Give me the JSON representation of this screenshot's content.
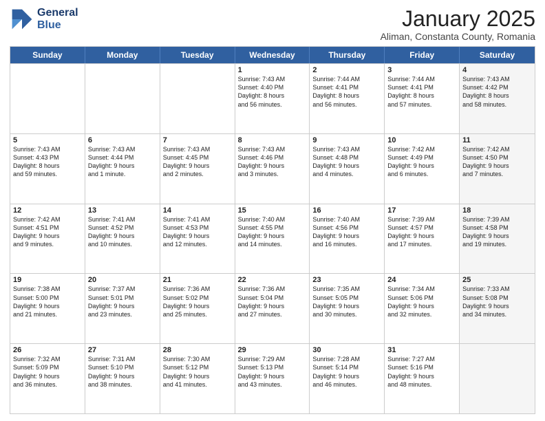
{
  "header": {
    "logo_line1": "General",
    "logo_line2": "Blue",
    "month": "January 2025",
    "location": "Aliman, Constanta County, Romania"
  },
  "days_of_week": [
    "Sunday",
    "Monday",
    "Tuesday",
    "Wednesday",
    "Thursday",
    "Friday",
    "Saturday"
  ],
  "weeks": [
    [
      {
        "num": "",
        "text": "",
        "shaded": false
      },
      {
        "num": "",
        "text": "",
        "shaded": false
      },
      {
        "num": "",
        "text": "",
        "shaded": false
      },
      {
        "num": "1",
        "text": "Sunrise: 7:43 AM\nSunset: 4:40 PM\nDaylight: 8 hours\nand 56 minutes.",
        "shaded": false
      },
      {
        "num": "2",
        "text": "Sunrise: 7:44 AM\nSunset: 4:41 PM\nDaylight: 8 hours\nand 56 minutes.",
        "shaded": false
      },
      {
        "num": "3",
        "text": "Sunrise: 7:44 AM\nSunset: 4:41 PM\nDaylight: 8 hours\nand 57 minutes.",
        "shaded": false
      },
      {
        "num": "4",
        "text": "Sunrise: 7:43 AM\nSunset: 4:42 PM\nDaylight: 8 hours\nand 58 minutes.",
        "shaded": true
      }
    ],
    [
      {
        "num": "5",
        "text": "Sunrise: 7:43 AM\nSunset: 4:43 PM\nDaylight: 8 hours\nand 59 minutes.",
        "shaded": false
      },
      {
        "num": "6",
        "text": "Sunrise: 7:43 AM\nSunset: 4:44 PM\nDaylight: 9 hours\nand 1 minute.",
        "shaded": false
      },
      {
        "num": "7",
        "text": "Sunrise: 7:43 AM\nSunset: 4:45 PM\nDaylight: 9 hours\nand 2 minutes.",
        "shaded": false
      },
      {
        "num": "8",
        "text": "Sunrise: 7:43 AM\nSunset: 4:46 PM\nDaylight: 9 hours\nand 3 minutes.",
        "shaded": false
      },
      {
        "num": "9",
        "text": "Sunrise: 7:43 AM\nSunset: 4:48 PM\nDaylight: 9 hours\nand 4 minutes.",
        "shaded": false
      },
      {
        "num": "10",
        "text": "Sunrise: 7:42 AM\nSunset: 4:49 PM\nDaylight: 9 hours\nand 6 minutes.",
        "shaded": false
      },
      {
        "num": "11",
        "text": "Sunrise: 7:42 AM\nSunset: 4:50 PM\nDaylight: 9 hours\nand 7 minutes.",
        "shaded": true
      }
    ],
    [
      {
        "num": "12",
        "text": "Sunrise: 7:42 AM\nSunset: 4:51 PM\nDaylight: 9 hours\nand 9 minutes.",
        "shaded": false
      },
      {
        "num": "13",
        "text": "Sunrise: 7:41 AM\nSunset: 4:52 PM\nDaylight: 9 hours\nand 10 minutes.",
        "shaded": false
      },
      {
        "num": "14",
        "text": "Sunrise: 7:41 AM\nSunset: 4:53 PM\nDaylight: 9 hours\nand 12 minutes.",
        "shaded": false
      },
      {
        "num": "15",
        "text": "Sunrise: 7:40 AM\nSunset: 4:55 PM\nDaylight: 9 hours\nand 14 minutes.",
        "shaded": false
      },
      {
        "num": "16",
        "text": "Sunrise: 7:40 AM\nSunset: 4:56 PM\nDaylight: 9 hours\nand 16 minutes.",
        "shaded": false
      },
      {
        "num": "17",
        "text": "Sunrise: 7:39 AM\nSunset: 4:57 PM\nDaylight: 9 hours\nand 17 minutes.",
        "shaded": false
      },
      {
        "num": "18",
        "text": "Sunrise: 7:39 AM\nSunset: 4:58 PM\nDaylight: 9 hours\nand 19 minutes.",
        "shaded": true
      }
    ],
    [
      {
        "num": "19",
        "text": "Sunrise: 7:38 AM\nSunset: 5:00 PM\nDaylight: 9 hours\nand 21 minutes.",
        "shaded": false
      },
      {
        "num": "20",
        "text": "Sunrise: 7:37 AM\nSunset: 5:01 PM\nDaylight: 9 hours\nand 23 minutes.",
        "shaded": false
      },
      {
        "num": "21",
        "text": "Sunrise: 7:36 AM\nSunset: 5:02 PM\nDaylight: 9 hours\nand 25 minutes.",
        "shaded": false
      },
      {
        "num": "22",
        "text": "Sunrise: 7:36 AM\nSunset: 5:04 PM\nDaylight: 9 hours\nand 27 minutes.",
        "shaded": false
      },
      {
        "num": "23",
        "text": "Sunrise: 7:35 AM\nSunset: 5:05 PM\nDaylight: 9 hours\nand 30 minutes.",
        "shaded": false
      },
      {
        "num": "24",
        "text": "Sunrise: 7:34 AM\nSunset: 5:06 PM\nDaylight: 9 hours\nand 32 minutes.",
        "shaded": false
      },
      {
        "num": "25",
        "text": "Sunrise: 7:33 AM\nSunset: 5:08 PM\nDaylight: 9 hours\nand 34 minutes.",
        "shaded": true
      }
    ],
    [
      {
        "num": "26",
        "text": "Sunrise: 7:32 AM\nSunset: 5:09 PM\nDaylight: 9 hours\nand 36 minutes.",
        "shaded": false
      },
      {
        "num": "27",
        "text": "Sunrise: 7:31 AM\nSunset: 5:10 PM\nDaylight: 9 hours\nand 38 minutes.",
        "shaded": false
      },
      {
        "num": "28",
        "text": "Sunrise: 7:30 AM\nSunset: 5:12 PM\nDaylight: 9 hours\nand 41 minutes.",
        "shaded": false
      },
      {
        "num": "29",
        "text": "Sunrise: 7:29 AM\nSunset: 5:13 PM\nDaylight: 9 hours\nand 43 minutes.",
        "shaded": false
      },
      {
        "num": "30",
        "text": "Sunrise: 7:28 AM\nSunset: 5:14 PM\nDaylight: 9 hours\nand 46 minutes.",
        "shaded": false
      },
      {
        "num": "31",
        "text": "Sunrise: 7:27 AM\nSunset: 5:16 PM\nDaylight: 9 hours\nand 48 minutes.",
        "shaded": false
      },
      {
        "num": "",
        "text": "",
        "shaded": true
      }
    ]
  ]
}
